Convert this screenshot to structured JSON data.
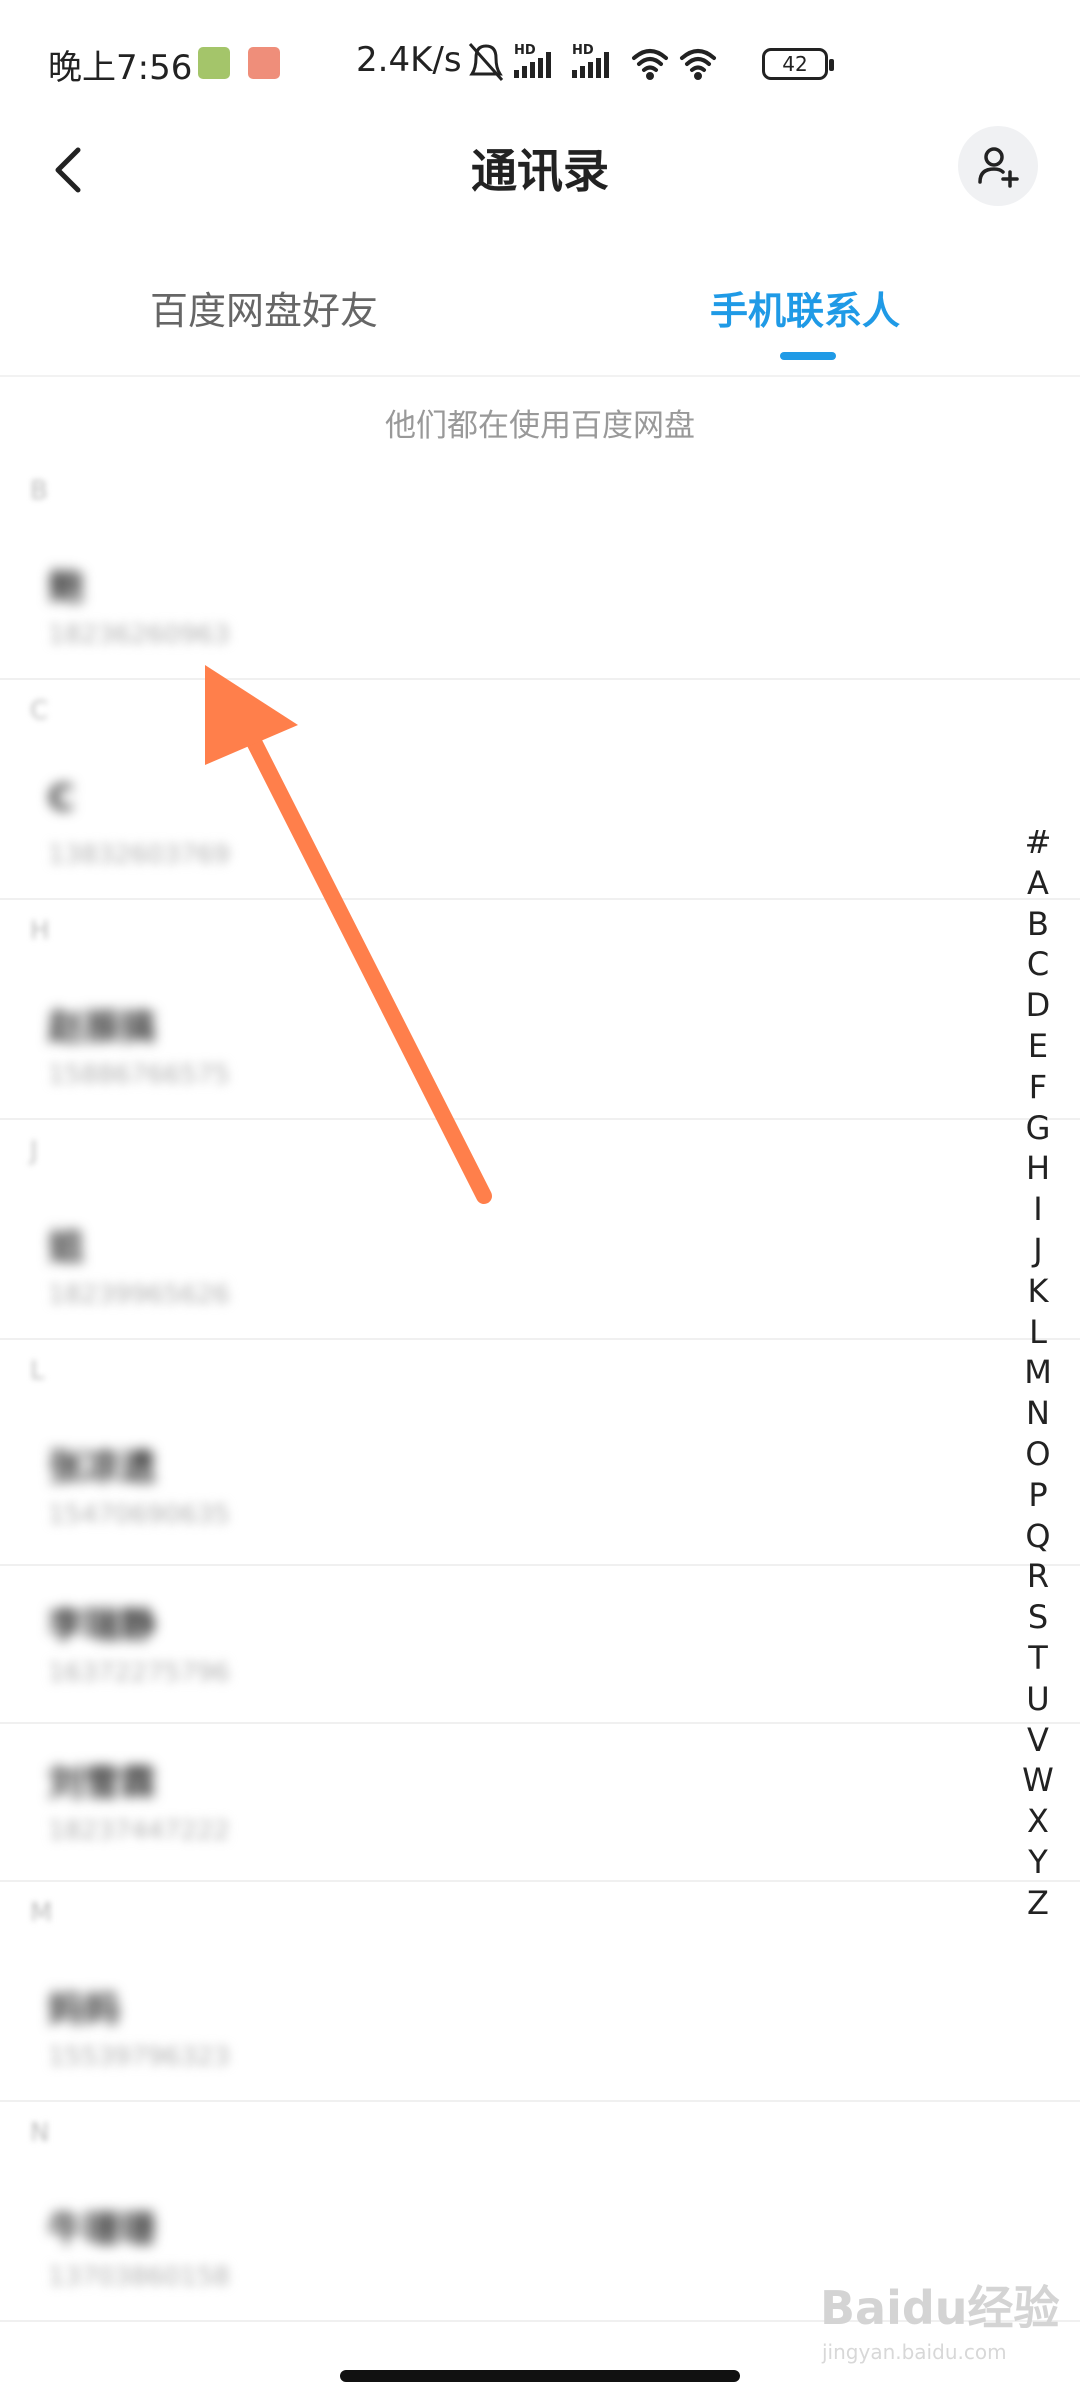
{
  "status_bar": {
    "time": "晚上7:56",
    "network_speed": "2.4K/s",
    "battery": "42",
    "icons": [
      "app-icon-green",
      "app-icon-red",
      "bell-off-icon",
      "hd-signal-icon",
      "hd-signal-icon",
      "wifi-icon",
      "wifi-icon",
      "battery-icon"
    ]
  },
  "header": {
    "title": "通讯录",
    "back_icon": "chevron-left-icon",
    "add_icon": "add-contact-icon"
  },
  "tabs": [
    {
      "label": "百度网盘好友",
      "active": false
    },
    {
      "label": "手机联系人",
      "active": true
    }
  ],
  "subtitle": "他们都在使用百度网盘",
  "contacts": {
    "sections": [
      {
        "letter": "B",
        "items": [
          {
            "name": "鲍",
            "phone": "18236260963"
          }
        ]
      },
      {
        "letter": "C",
        "items": [
          {
            "name": "C",
            "phone": "13832603769"
          }
        ]
      },
      {
        "letter": "H",
        "items": [
          {
            "name": "赵振搞",
            "phone": "15886766575"
          }
        ]
      },
      {
        "letter": "J",
        "items": [
          {
            "name": "姐",
            "phone": "18239965626"
          }
        ]
      },
      {
        "letter": "L",
        "items": [
          {
            "name": "张凉遗",
            "phone": "15470690635"
          },
          {
            "name": "李瑞静",
            "phone": "16372275796"
          },
          {
            "name": "刘雪霖",
            "phone": "18237447222"
          }
        ]
      },
      {
        "letter": "M",
        "items": [
          {
            "name": "妈妈",
            "phone": "15539796323"
          }
        ]
      },
      {
        "letter": "N",
        "items": [
          {
            "name": "牛珊珊",
            "phone": "13703860158"
          }
        ]
      }
    ]
  },
  "alphabet_index": [
    "#",
    "A",
    "B",
    "C",
    "D",
    "E",
    "F",
    "G",
    "H",
    "I",
    "J",
    "K",
    "L",
    "M",
    "N",
    "O",
    "P",
    "Q",
    "R",
    "S",
    "T",
    "U",
    "V",
    "W",
    "X",
    "Y",
    "Z"
  ],
  "colors": {
    "accent": "#1f9ae6",
    "arrow": "#ff7f4b"
  },
  "watermark": {
    "text": "Baidu经验",
    "sub": "jingyan.baidu.com"
  }
}
